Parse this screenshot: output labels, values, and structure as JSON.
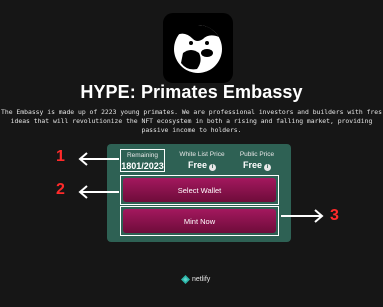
{
  "header": {
    "title": "HYPE: Primates Embassy",
    "description_lines": [
      "The Embassy is made up of 2223 young primates. We are professional investors and builders with fres",
      "ideas that will revolutionize the NFT ecosystem in both a rising and falling market, providing",
      "passive income to holders."
    ]
  },
  "mint_panel": {
    "remaining": {
      "label": "Remaining",
      "value": "1801/2023"
    },
    "whitelist_price": {
      "label": "White List Price",
      "value": "Free"
    },
    "public_price": {
      "label": "Public Price",
      "value": "Free"
    },
    "select_wallet_label": "Select Wallet",
    "mint_now_label": "Mint Now"
  },
  "annotations": {
    "one": "1",
    "two": "2",
    "three": "3"
  },
  "footer": {
    "brand": "netlify"
  },
  "colors": {
    "accent": "#ff2a2a",
    "panel": "#2e6154",
    "button": "#8e1450",
    "background": "#161616"
  },
  "icons": [
    "ape-logo-icon",
    "info-icon",
    "arrow-left-icon",
    "arrow-right-icon",
    "netlify-icon"
  ]
}
